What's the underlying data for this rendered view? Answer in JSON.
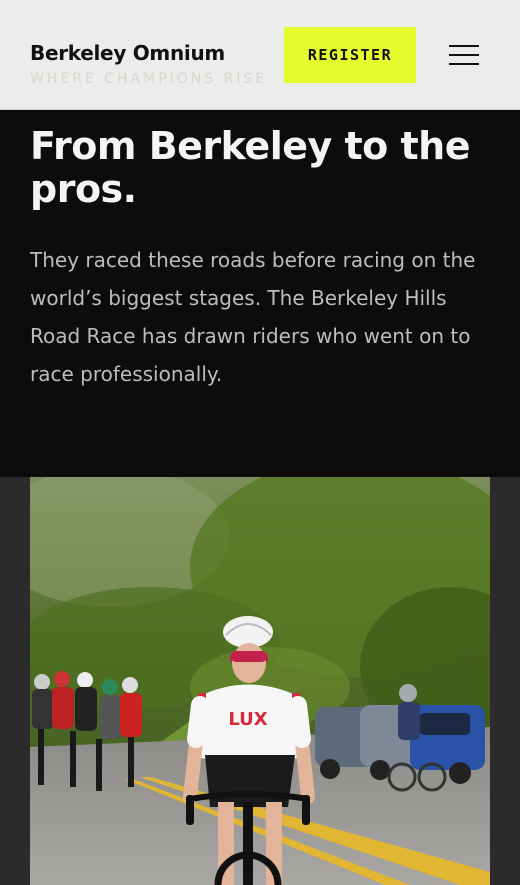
{
  "header": {
    "logo": "Berkeley Omnium",
    "eyebrow": "WHERE CHAMPIONS RISE",
    "register_label": "REGISTER",
    "menu_icon": "hamburger-menu-icon"
  },
  "hero": {
    "title": "From Berkeley to the pros.",
    "body": "They raced these roads before racing on the world’s biggest stages. The Berkeley Hills Road Race has drawn riders who went on to race professionally."
  },
  "photo": {
    "jersey_text": "LUX"
  },
  "colors": {
    "accent": "#e4fb2c",
    "header_bg": "#ececea",
    "hero_bg": "#0c0c0c",
    "band_bg": "#2b2b2b"
  }
}
